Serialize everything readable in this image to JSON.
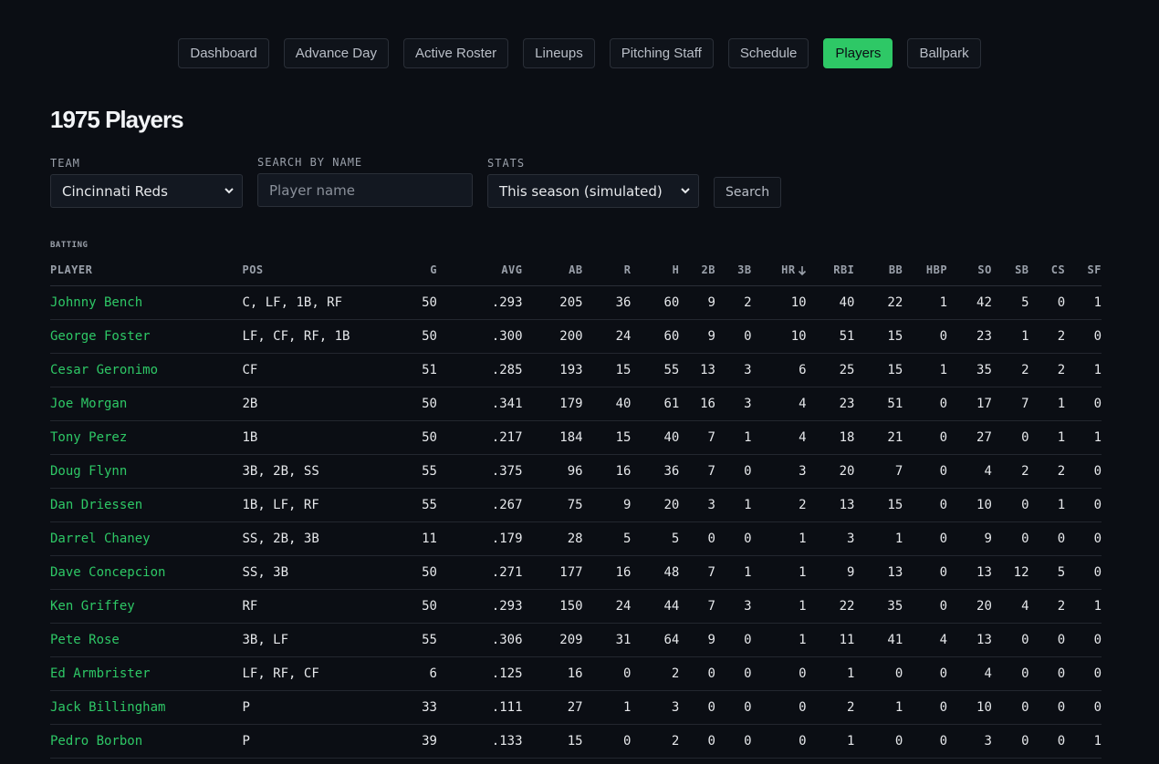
{
  "nav": [
    {
      "label": "Dashboard",
      "active": false
    },
    {
      "label": "Advance Day",
      "active": false
    },
    {
      "label": "Active Roster",
      "active": false
    },
    {
      "label": "Lineups",
      "active": false
    },
    {
      "label": "Pitching Staff",
      "active": false
    },
    {
      "label": "Schedule",
      "active": false
    },
    {
      "label": "Players",
      "active": true
    },
    {
      "label": "Ballpark",
      "active": false
    }
  ],
  "page": {
    "title": "1975 Players"
  },
  "filters": {
    "team": {
      "label": "TEAM",
      "value": "Cincinnati Reds"
    },
    "name": {
      "label": "SEARCH BY NAME",
      "placeholder": "Player name",
      "value": ""
    },
    "stats": {
      "label": "STATS",
      "value": "This season (simulated)"
    },
    "search_label": "Search"
  },
  "batting": {
    "section_label": "BATTING",
    "sorted_column": "HR",
    "columns": [
      "PLAYER",
      "POS",
      "G",
      "AVG",
      "AB",
      "R",
      "H",
      "2B",
      "3B",
      "HR",
      "RBI",
      "BB",
      "HBP",
      "SO",
      "SB",
      "CS",
      "SF"
    ],
    "rows": [
      [
        "Johnny Bench",
        "C, LF, 1B, RF",
        "50",
        ".293",
        "205",
        "36",
        "60",
        "9",
        "2",
        "10",
        "40",
        "22",
        "1",
        "42",
        "5",
        "0",
        "1"
      ],
      [
        "George Foster",
        "LF, CF, RF, 1B",
        "50",
        ".300",
        "200",
        "24",
        "60",
        "9",
        "0",
        "10",
        "51",
        "15",
        "0",
        "23",
        "1",
        "2",
        "0"
      ],
      [
        "Cesar Geronimo",
        "CF",
        "51",
        ".285",
        "193",
        "15",
        "55",
        "13",
        "3",
        "6",
        "25",
        "15",
        "1",
        "35",
        "2",
        "2",
        "1"
      ],
      [
        "Joe Morgan",
        "2B",
        "50",
        ".341",
        "179",
        "40",
        "61",
        "16",
        "3",
        "4",
        "23",
        "51",
        "0",
        "17",
        "7",
        "1",
        "0"
      ],
      [
        "Tony Perez",
        "1B",
        "50",
        ".217",
        "184",
        "15",
        "40",
        "7",
        "1",
        "4",
        "18",
        "21",
        "0",
        "27",
        "0",
        "1",
        "1"
      ],
      [
        "Doug Flynn",
        "3B, 2B, SS",
        "55",
        ".375",
        "96",
        "16",
        "36",
        "7",
        "0",
        "3",
        "20",
        "7",
        "0",
        "4",
        "2",
        "2",
        "0"
      ],
      [
        "Dan Driessen",
        "1B, LF, RF",
        "55",
        ".267",
        "75",
        "9",
        "20",
        "3",
        "1",
        "2",
        "13",
        "15",
        "0",
        "10",
        "0",
        "1",
        "0"
      ],
      [
        "Darrel Chaney",
        "SS, 2B, 3B",
        "11",
        ".179",
        "28",
        "5",
        "5",
        "0",
        "0",
        "1",
        "3",
        "1",
        "0",
        "9",
        "0",
        "0",
        "0"
      ],
      [
        "Dave Concepcion",
        "SS, 3B",
        "50",
        ".271",
        "177",
        "16",
        "48",
        "7",
        "1",
        "1",
        "9",
        "13",
        "0",
        "13",
        "12",
        "5",
        "0"
      ],
      [
        "Ken Griffey",
        "RF",
        "50",
        ".293",
        "150",
        "24",
        "44",
        "7",
        "3",
        "1",
        "22",
        "35",
        "0",
        "20",
        "4",
        "2",
        "1"
      ],
      [
        "Pete Rose",
        "3B, LF",
        "55",
        ".306",
        "209",
        "31",
        "64",
        "9",
        "0",
        "1",
        "11",
        "41",
        "4",
        "13",
        "0",
        "0",
        "0"
      ],
      [
        "Ed Armbrister",
        "LF, RF, CF",
        "6",
        ".125",
        "16",
        "0",
        "2",
        "0",
        "0",
        "0",
        "1",
        "0",
        "0",
        "4",
        "0",
        "0",
        "0"
      ],
      [
        "Jack Billingham",
        "P",
        "33",
        ".111",
        "27",
        "1",
        "3",
        "0",
        "0",
        "0",
        "2",
        "1",
        "0",
        "10",
        "0",
        "0",
        "0"
      ],
      [
        "Pedro Borbon",
        "P",
        "39",
        ".133",
        "15",
        "0",
        "2",
        "0",
        "0",
        "0",
        "1",
        "0",
        "0",
        "3",
        "0",
        "0",
        "1"
      ]
    ]
  }
}
